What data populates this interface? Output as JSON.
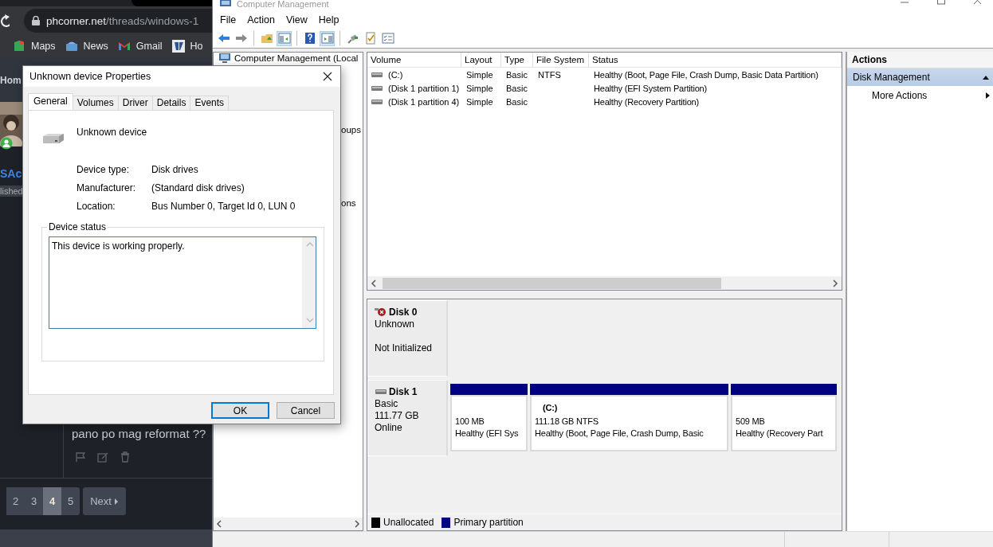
{
  "browser": {
    "address": {
      "host": "phcorner.net",
      "path": "/threads/windows-1"
    },
    "bookmarks": [
      {
        "label": "Maps",
        "kind": "maps"
      },
      {
        "label": "News",
        "kind": "news"
      },
      {
        "label": "Gmail",
        "kind": "gmail"
      },
      {
        "label": "Ho",
        "kind": "site"
      }
    ],
    "page": {
      "nav_label": "Hom",
      "username": "SAc",
      "user_meta": "lished",
      "post_text": "pano po mag reformat ??",
      "pages": [
        {
          "label": "2",
          "selected": false
        },
        {
          "label": "3",
          "selected": false
        },
        {
          "label": "4",
          "selected": true
        },
        {
          "label": "5",
          "selected": false
        }
      ],
      "next_label": "Next"
    }
  },
  "window": {
    "title": "Computer Management",
    "menu": [
      "File",
      "Action",
      "View",
      "Help"
    ],
    "toolbar": [
      {
        "kind": "back"
      },
      {
        "kind": "forward"
      },
      {
        "kind": "separator"
      },
      {
        "kind": "folder"
      },
      {
        "kind": "tree",
        "pressed": true
      },
      {
        "kind": "separator"
      },
      {
        "kind": "help"
      },
      {
        "kind": "actionpane",
        "pressed": true
      },
      {
        "kind": "separator"
      },
      {
        "kind": "connect"
      },
      {
        "kind": "check"
      },
      {
        "kind": "list"
      }
    ],
    "tree": [
      {
        "label": "Computer Management (Local",
        "kind": "root"
      },
      {
        "label": "oups",
        "kind": "child"
      },
      {
        "label": "ons",
        "kind": "child"
      }
    ],
    "volumes": {
      "columns": [
        "Volume",
        "Layout",
        "Type",
        "File System",
        "Status"
      ],
      "rows": [
        {
          "volume": "(C:)",
          "layout": "Simple",
          "type": "Basic",
          "file_system": "NTFS",
          "status": "Healthy (Boot, Page File, Crash Dump, Basic Data Partition)"
        },
        {
          "volume": "(Disk 1 partition 1)",
          "layout": "Simple",
          "type": "Basic",
          "status": "Healthy (EFI System Partition)"
        },
        {
          "volume": "(Disk 1 partition 4)",
          "layout": "Simple",
          "type": "Basic",
          "status": "Healthy (Recovery Partition)"
        }
      ]
    },
    "disks": [
      {
        "name": "Disk 0",
        "kind": "uninitialized",
        "type": "Unknown",
        "state": "Not Initialized"
      },
      {
        "name": "Disk 1",
        "kind": "basic",
        "type": "Basic",
        "size": "111.77 GB",
        "state": "Online",
        "partitions": [
          {
            "size": "100 MB",
            "status": "Healthy (EFI Sys",
            "color": "#000080"
          },
          {
            "label": "(C:)",
            "size": "111.18 GB NTFS",
            "status": "Healthy (Boot, Page File, Crash Dump, Basic",
            "color": "#000080"
          },
          {
            "size": "509 MB",
            "status": "Healthy (Recovery Part",
            "color": "#000080"
          }
        ]
      }
    ],
    "legend": [
      {
        "label": "Unallocated",
        "color": "#000000"
      },
      {
        "label": "Primary partition",
        "color": "#000080"
      }
    ],
    "actions": {
      "header": "Actions",
      "sections": [
        {
          "label": "Disk Management",
          "expanded": true,
          "items": [
            {
              "label": "More Actions"
            }
          ]
        }
      ]
    }
  },
  "dialog": {
    "title": "Unknown device Properties",
    "tabs": [
      {
        "label": "General",
        "selected": true
      },
      {
        "label": "Volumes",
        "selected": false
      },
      {
        "label": "Driver",
        "selected": false
      },
      {
        "label": "Details",
        "selected": false
      },
      {
        "label": "Events",
        "selected": false
      }
    ],
    "device_name": "Unknown device",
    "properties": [
      {
        "label": "Device type:",
        "value": "Disk drives"
      },
      {
        "label": "Manufacturer:",
        "value": "(Standard disk drives)"
      },
      {
        "label": "Location:",
        "value": "Bus Number 0, Target Id 0, LUN 0"
      }
    ],
    "status_group": "Device status",
    "status_text": "This device is working properly.",
    "buttons": [
      {
        "label": "OK",
        "default": true
      },
      {
        "label": "Cancel",
        "default": false
      }
    ]
  }
}
